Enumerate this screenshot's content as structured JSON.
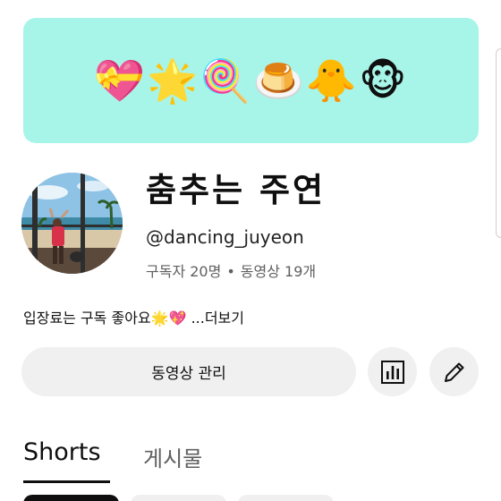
{
  "banner": {
    "emojis": "💝🌟🍭🍮🐥🐵"
  },
  "channel": {
    "name": "춤추는 주연",
    "handle": "@dancing_juyeon",
    "subscribers": "구독자 20명",
    "separator": "•",
    "videos": "동영상 19개",
    "description": "입장료는 구독 좋아요🌟💖 ...더보기"
  },
  "actions": {
    "manage_label": "동영상 관리",
    "analytics_icon": "bar-chart-icon",
    "edit_icon": "pencil-icon"
  },
  "tabs": [
    {
      "label": "Shorts",
      "selected": true
    },
    {
      "label": "게시물",
      "selected": false
    }
  ],
  "colors": {
    "banner_bg": "#a7f5e8",
    "button_bg": "#f0f0f0",
    "text_primary": "#0f0f0f",
    "text_secondary": "#606060"
  }
}
